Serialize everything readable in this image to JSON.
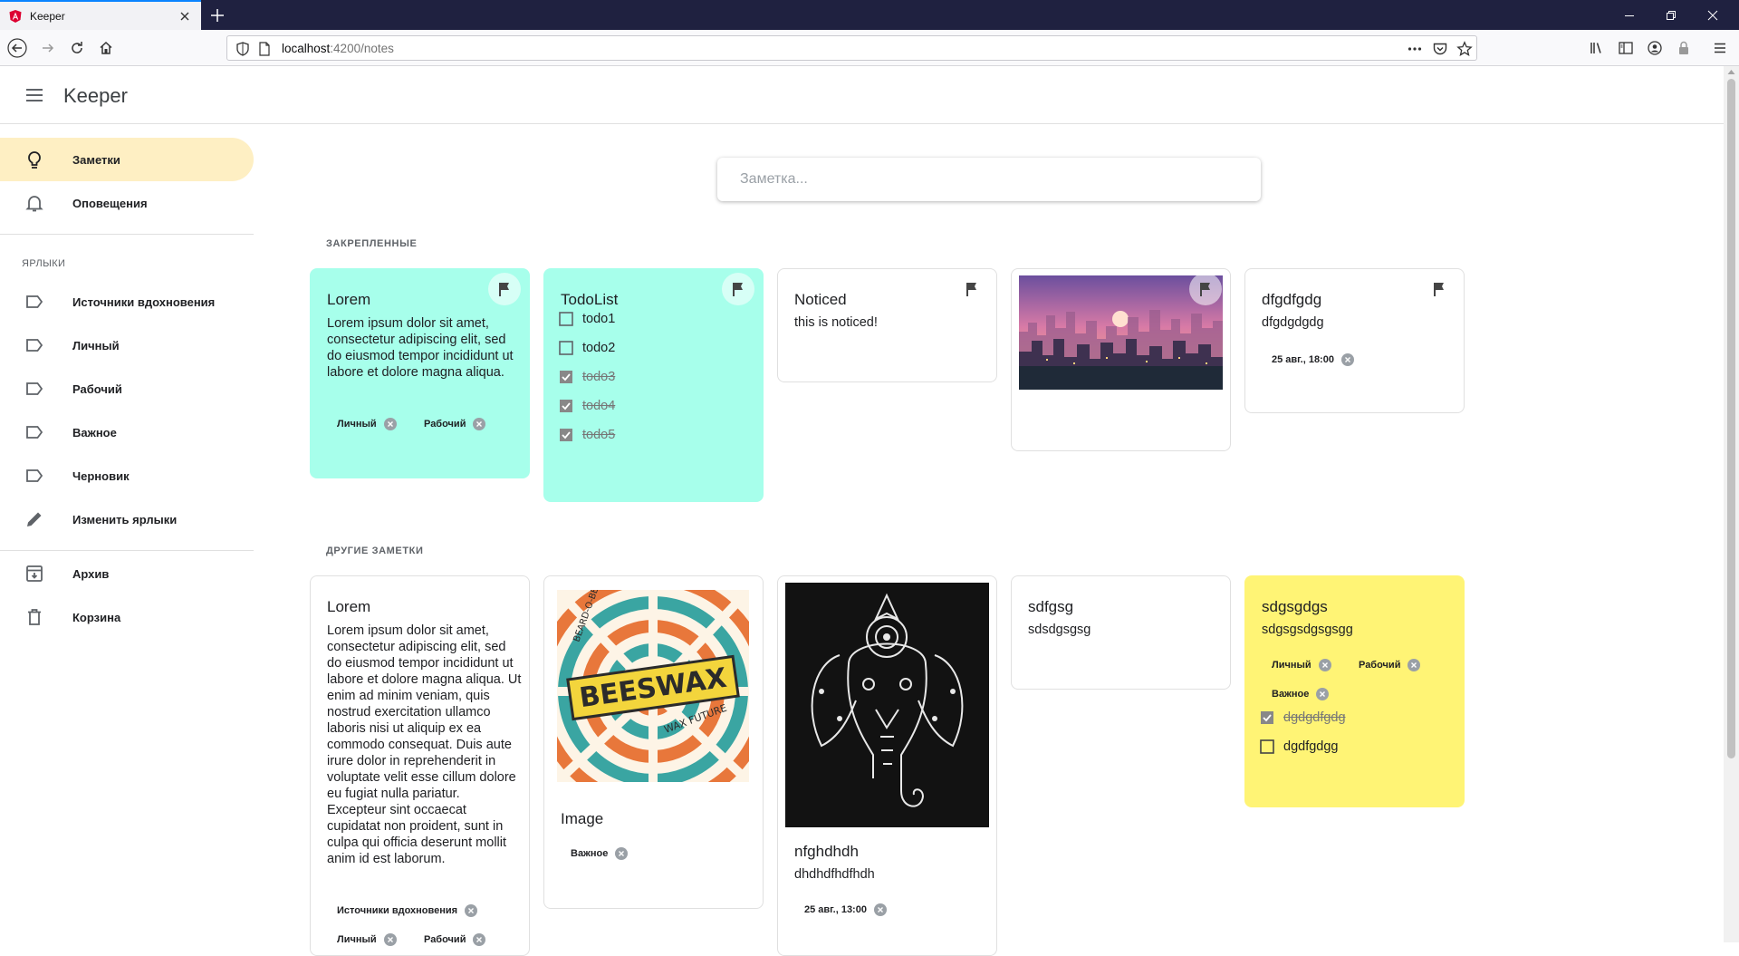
{
  "browser": {
    "tab_title": "Keeper",
    "url_host": "localhost",
    "url_path": ":4200/notes"
  },
  "app": {
    "title": "Keeper",
    "search_placeholder": "Заметка..."
  },
  "sidebar": {
    "notes": "Заметки",
    "reminders": "Оповещения",
    "labels_heading": "ЯРЛЫКИ",
    "labels": [
      "Источники вдохновения",
      "Личный",
      "Рабочий",
      "Важное",
      "Черновик"
    ],
    "edit_labels": "Изменить ярлыки",
    "archive": "Архив",
    "trash": "Корзина"
  },
  "sections": {
    "pinned": "ЗАКРЕПЛЕННЫЕ",
    "others": "ДРУГИЕ ЗАМЕТКИ"
  },
  "pinned_notes": [
    {
      "title": "Lorem",
      "text": "Lorem ipsum dolor sit amet, consectetur adipiscing elit, sed do eiusmod tempor incididunt ut labore et dolore magna aliqua.",
      "labels": [
        "Личный",
        "Рабочий"
      ]
    },
    {
      "title": "TodoList",
      "todos": [
        {
          "text": "todo1",
          "done": false
        },
        {
          "text": "todo2",
          "done": false
        },
        {
          "text": "todo3",
          "done": true
        },
        {
          "text": "todo4",
          "done": true
        },
        {
          "text": "todo5",
          "done": true
        }
      ]
    },
    {
      "title": "Noticed",
      "text": "this is noticed!"
    },
    {
      "image": "pixel-city-sunset"
    },
    {
      "title": "dfgdfgdg",
      "text": "dfgdgdgdg",
      "reminder": "25 авг., 18:00"
    }
  ],
  "other_notes": [
    {
      "title": "Lorem",
      "text": "Lorem ipsum dolor sit amet, consectetur adipiscing elit, sed do eiusmod tempor incididunt ut labore et dolore magna aliqua. Ut enim ad minim veniam, quis nostrud exercitation ullamco laboris nisi ut aliquip ex ea commodo consequat. Duis aute irure dolor in reprehenderit in voluptate velit esse cillum dolore eu fugiat nulla pariatur. Excepteur sint occaecat cupidatat non proident, sunt in culpa qui officia deserunt mollit anim id est laborum.",
      "labels": [
        "Источники вдохновения",
        "Личный",
        "Рабочий"
      ]
    },
    {
      "title": "Image",
      "image": "beeswax-poster",
      "image_text_1": "BEARD-O-BEES",
      "image_text_2": "BEESWAX",
      "image_text_3": "WAX FUTURE",
      "labels": [
        "Важное"
      ]
    },
    {
      "title": "nfghdhdh",
      "text": "dhdhdfhdfhdh",
      "image": "mandala-elephant",
      "reminder": "25 авг., 13:00"
    },
    {
      "title": "sdfgsg",
      "text": "sdsdgsgsg"
    },
    {
      "title": "sdgsgdgs",
      "text": "sdgsgsdgsgsgg",
      "labels": [
        "Личный",
        "Рабочий",
        "Важное"
      ],
      "todos": [
        {
          "text": "dgdgdfgdg",
          "done": true
        },
        {
          "text": "dgdfgdgg",
          "done": false
        }
      ]
    }
  ],
  "colors": {
    "teal": "#a7ffeb",
    "yellow": "#fff475",
    "active_nav": "#feefc3"
  }
}
